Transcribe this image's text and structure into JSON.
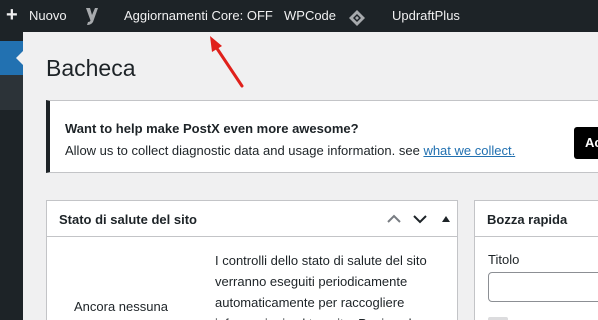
{
  "adminbar": {
    "plus_glyph": "+",
    "new_label": "Nuovo",
    "core_updates_label": "Aggiornamenti Core: OFF",
    "wpcode_label": "WPCode",
    "updraft_label": "UpdraftPlus"
  },
  "page": {
    "title": "Bacheca"
  },
  "notice": {
    "title": "Want to help make PostX even more awesome?",
    "text": "Allow us to collect diagnostic data and usage information. see ",
    "link": "what we collect.",
    "button": "Accept"
  },
  "health_panel": {
    "title": "Stato di salute del sito",
    "left_text": "Ancora nessuna",
    "description": "I controlli dello stato di salute del sito verranno eseguiti periodicamente automaticamente per raccogliere informazioni sul tuo sito. Puoi anche"
  },
  "draft_panel": {
    "title": "Bozza rapida",
    "title_label": "Titolo"
  },
  "colors": {
    "adminbar_bg": "#1d2327",
    "accent": "#2271b1",
    "annotation_arrow": "#e0201b"
  }
}
